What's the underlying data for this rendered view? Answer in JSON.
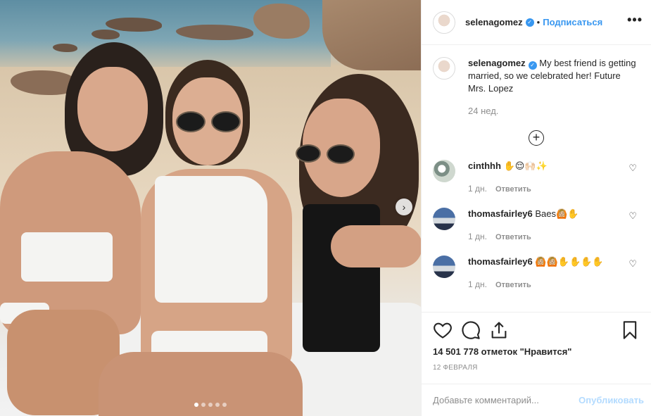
{
  "post": {
    "author": "selenagomez",
    "follow_label": "Подписаться",
    "more_label": "•••",
    "caption": "My best friend is getting married, so we celebrated her! Future Mrs. Lopez",
    "caption_time": "24 нед.",
    "likes": "14 501 778 отметок \"Нравится\"",
    "date": "12 ФЕВРАЛЯ",
    "carousel_count": 5,
    "carousel_active": 1
  },
  "comments": [
    {
      "user": "cinthhh",
      "text": "✋😌🙌🏻✨",
      "time": "1 дн.",
      "reply": "Ответить"
    },
    {
      "user": "thomasfairley6",
      "text": "Baes🙆🏼✋",
      "time": "1 дн.",
      "reply": "Ответить"
    },
    {
      "user": "thomasfairley6",
      "text": "🙆🏼🙆🏼✋✋✋✋",
      "time": "1 дн.",
      "reply": "Ответить"
    }
  ],
  "comment_box": {
    "placeholder": "Добавьте комментарий...",
    "publish_label": "Опубликовать"
  },
  "colors": {
    "link_blue": "#3897f0",
    "muted": "#8e8e8e",
    "publish_disabled": "#b3dbff"
  }
}
